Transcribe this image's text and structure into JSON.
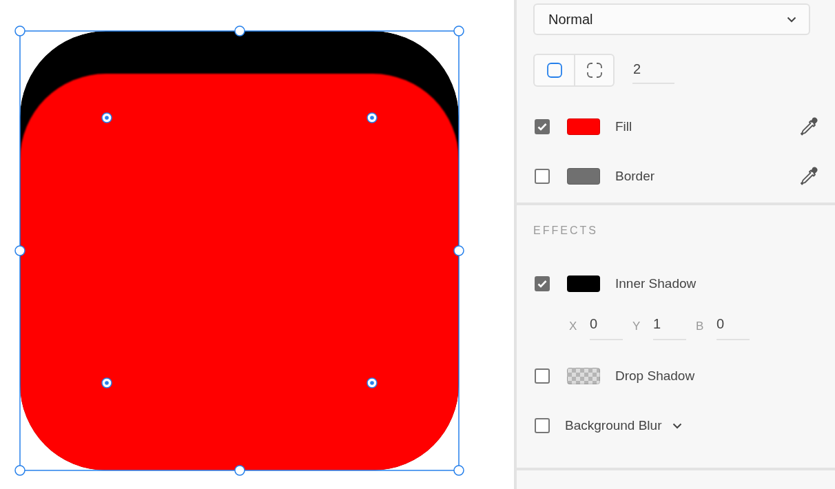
{
  "blend_mode": {
    "value": "Normal"
  },
  "corner": {
    "modes": [
      {
        "kind": "all",
        "selected": true
      },
      {
        "kind": "each",
        "selected": false
      }
    ],
    "radius": "2"
  },
  "appearance": [
    {
      "label": "Fill",
      "checked": true,
      "color": "#ff0000"
    },
    {
      "label": "Border",
      "checked": false,
      "color": "#707070"
    }
  ],
  "effects": {
    "title": "EFFECTS",
    "items": [
      {
        "kind": "shadow",
        "label": "Inner Shadow",
        "checked": true,
        "color": "#000000",
        "params": [
          {
            "label": "X",
            "value": "0"
          },
          {
            "label": "Y",
            "value": "1"
          },
          {
            "label": "B",
            "value": "0"
          }
        ]
      },
      {
        "kind": "checker",
        "label": "Drop Shadow",
        "checked": false
      },
      {
        "kind": "dropdown",
        "label": "Background Blur",
        "checked": false
      }
    ]
  }
}
